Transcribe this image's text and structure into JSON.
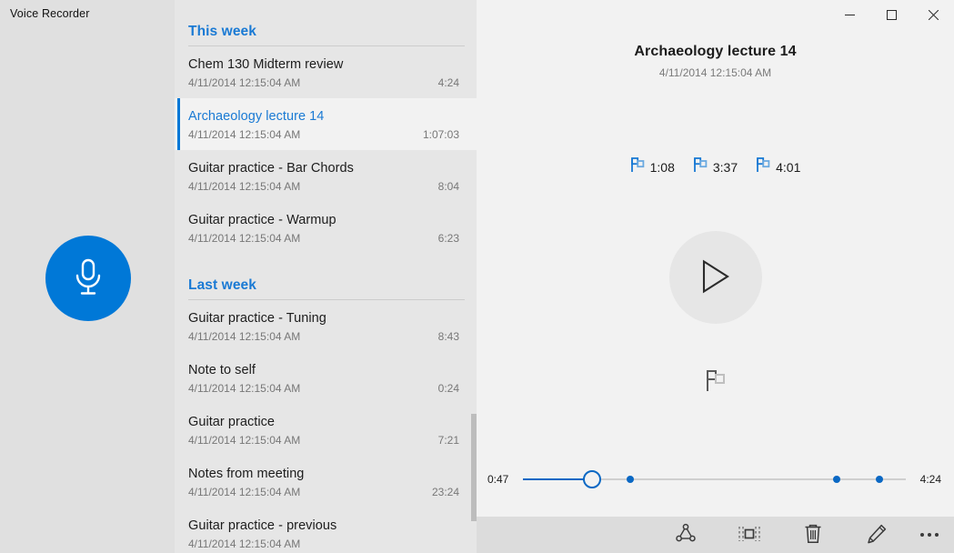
{
  "window": {
    "title": "Voice Recorder",
    "controls": [
      {
        "name": "minimize",
        "label": "Minimize"
      },
      {
        "name": "maximize",
        "label": "Maximize"
      },
      {
        "name": "close",
        "label": "Close"
      }
    ]
  },
  "colors": {
    "accent": "#0078d7",
    "accent_link": "#1a7ad4",
    "seek_fill": "#0a68c4",
    "left_pane_bg": "#e0e0e0",
    "list_pane_bg": "#e6e6e6",
    "detail_pane_bg": "#f2f2f2",
    "toolbar_bg": "#dcdcdc"
  },
  "record": {
    "icon": "microphone-icon",
    "label": "Record"
  },
  "list": {
    "groups": [
      {
        "header": "This week",
        "items": [
          {
            "title": "Chem 130 Midterm review",
            "date": "4/11/2014 12:15:04 AM",
            "duration": "4:24",
            "selected": false
          },
          {
            "title": "Archaeology lecture 14",
            "date": "4/11/2014 12:15:04 AM",
            "duration": "1:07:03",
            "selected": true
          },
          {
            "title": "Guitar practice - Bar Chords",
            "date": "4/11/2014 12:15:04 AM",
            "duration": "8:04",
            "selected": false
          },
          {
            "title": "Guitar practice - Warmup",
            "date": "4/11/2014 12:15:04 AM",
            "duration": "6:23",
            "selected": false
          }
        ]
      },
      {
        "header": "Last week",
        "items": [
          {
            "title": "Guitar practice - Tuning",
            "date": "4/11/2014 12:15:04 AM",
            "duration": "8:43",
            "selected": false
          },
          {
            "title": "Note to self",
            "date": "4/11/2014 12:15:04 AM",
            "duration": "0:24",
            "selected": false
          },
          {
            "title": "Guitar practice",
            "date": "4/11/2014 12:15:04 AM",
            "duration": "7:21",
            "selected": false
          },
          {
            "title": "Notes from meeting",
            "date": "4/11/2014 12:15:04 AM",
            "duration": "23:24",
            "selected": false
          },
          {
            "title": "Guitar practice - previous",
            "date": "4/11/2014 12:15:04 AM",
            "duration": "",
            "selected": false
          }
        ]
      }
    ]
  },
  "detail": {
    "title": "Archaeology lecture 14",
    "date": "4/11/2014 12:15:04 AM",
    "flags": [
      {
        "icon": "flag-icon",
        "time": "1:08"
      },
      {
        "icon": "flag-icon",
        "time": "3:37"
      },
      {
        "icon": "flag-icon",
        "time": "4:01"
      }
    ],
    "play": {
      "icon": "play-icon",
      "label": "Play"
    },
    "add_flag": {
      "icon": "flag-icon",
      "label": "Add flag"
    },
    "seek": {
      "current": "0:47",
      "total": "4:24",
      "progress_percent": 18,
      "markers_percent": [
        28,
        82,
        93
      ]
    }
  },
  "toolbar": {
    "buttons": [
      {
        "name": "share-button",
        "icon": "share-icon",
        "label": "Share"
      },
      {
        "name": "trim-button",
        "icon": "trim-icon",
        "label": "Trim"
      },
      {
        "name": "delete-button",
        "icon": "trash-icon",
        "label": "Delete"
      },
      {
        "name": "rename-button",
        "icon": "pencil-icon",
        "label": "Rename"
      },
      {
        "name": "more-button",
        "icon": "ellipsis-icon",
        "label": "More"
      }
    ]
  }
}
